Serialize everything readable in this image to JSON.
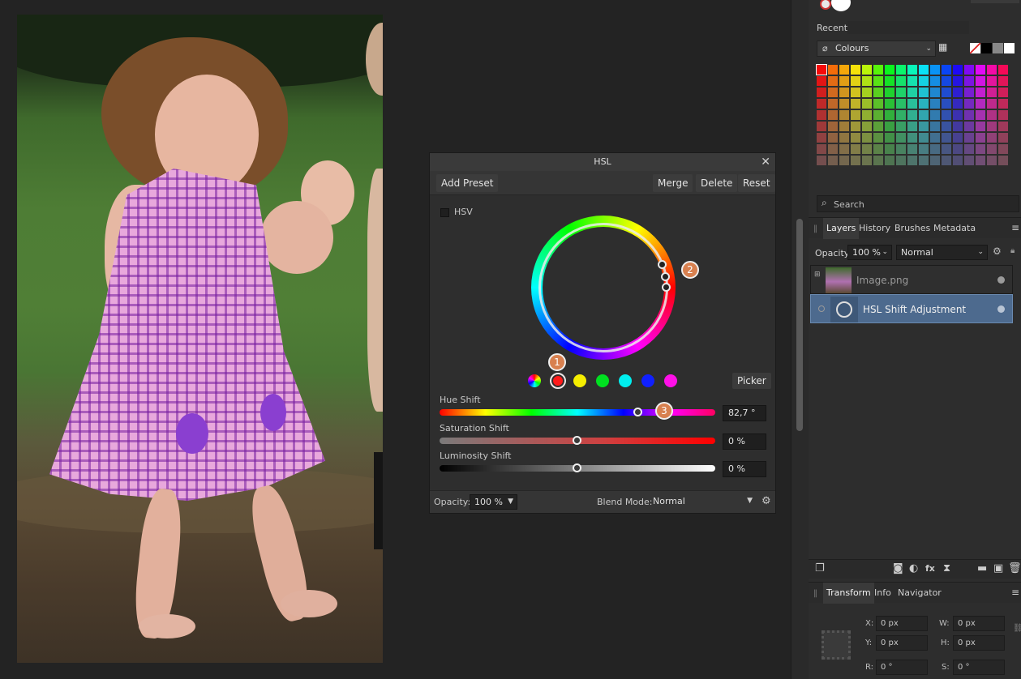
{
  "hsl_dialog": {
    "title": "HSL",
    "toolbar": {
      "add_preset": "Add Preset",
      "merge": "Merge",
      "delete": "Delete",
      "reset": "Reset"
    },
    "hsv_label": "HSV",
    "picker_label": "Picker",
    "badges": [
      "1",
      "2",
      "3"
    ],
    "hue_shift": {
      "label": "Hue Shift",
      "value": "82,7 °"
    },
    "saturation_shift": {
      "label": "Saturation Shift",
      "value": "0 %"
    },
    "luminosity_shift": {
      "label": "Luminosity Shift",
      "value": "0 %"
    },
    "footer": {
      "opacity_label": "Opacity:",
      "opacity_value": "100 %",
      "blend_label": "Blend Mode:",
      "blend_value": "Normal"
    },
    "swatch_colors": [
      "#ff1a1a",
      "#f5ee00",
      "#00e020",
      "#00eeee",
      "#1020ff",
      "#ff10e8"
    ]
  },
  "colours_panel": {
    "recent_label": "Recent:",
    "palette_name": "Colours"
  },
  "search": {
    "placeholder": "Search"
  },
  "layers_panel": {
    "tabs": [
      "Layers",
      "History",
      "Brushes",
      "Metadata"
    ],
    "opacity_label": "Opacity:",
    "opacity_value": "100 %",
    "blend_value": "Normal",
    "layers": [
      {
        "name": "Image.png"
      },
      {
        "name": "HSL Shift Adjustment"
      }
    ]
  },
  "transform_panel": {
    "tabs": [
      "Transform",
      "Info",
      "Navigator"
    ],
    "x_label": "X:",
    "x_value": "0 px",
    "y_label": "Y:",
    "y_value": "0 px",
    "w_label": "W:",
    "w_value": "0 px",
    "h_label": "H:",
    "h_value": "0 px",
    "r_label": "R:",
    "r_value": "0 °",
    "s_label": "S:",
    "s_value": "0 °"
  },
  "colors": {
    "accent_selected_layer": "#4d6a8e",
    "badge": "#d8804f"
  }
}
